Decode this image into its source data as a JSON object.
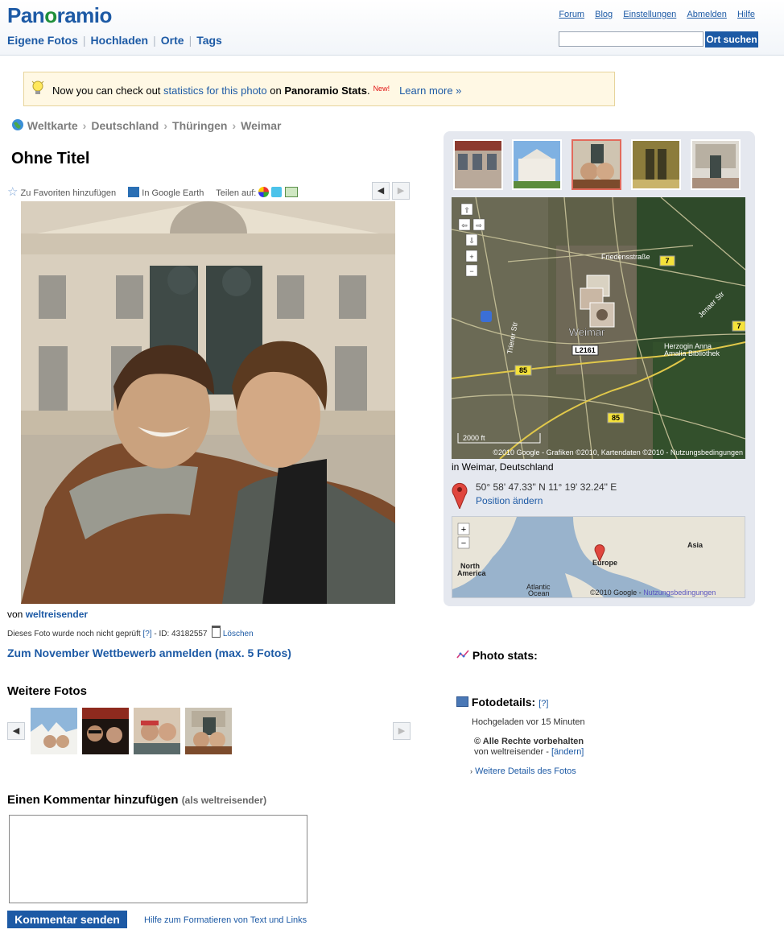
{
  "header": {
    "logo_part1": "Pan",
    "logo_part2": "ramio",
    "nav": [
      "Eigene Fotos",
      "Hochladen",
      "Orte",
      "Tags"
    ],
    "links": [
      "Forum",
      "Blog",
      "Einstellungen",
      "Abmelden",
      "Hilfe"
    ],
    "search_value": "",
    "search_button": "Ort suchen"
  },
  "notice": {
    "pre": "Now you can check out ",
    "link": "statistics for this photo",
    "mid": " on ",
    "brand": "Panoramio Stats",
    "dot": ".",
    "new": "New!",
    "learn_more": "Learn more »"
  },
  "breadcrumb": [
    "Weltkarte",
    "Deutschland",
    "Thüringen",
    "Weimar"
  ],
  "photo": {
    "title": "Ohne Titel",
    "favorite": "Zu Favoriten hinzufügen",
    "google_earth": "In Google Earth",
    "share": "Teilen auf:",
    "by_label": "von ",
    "author": "weltreisender",
    "status": "Dieses Foto wurde noch nicht geprüft",
    "status_help": "[?]",
    "id_text": " - ID: 43182557",
    "delete": "Löschen",
    "contest": "Zum November Wettbewerb anmelden (max. 5 Fotos)"
  },
  "more_photos": {
    "title": "Weitere Fotos"
  },
  "comment": {
    "title": "Einen Kommentar hinzufügen",
    "as_user": "(als weltreisender)",
    "value": "",
    "submit": "Kommentar senden",
    "format_help": "Hilfe zum Formatieren von Text und Links"
  },
  "map": {
    "labels": {
      "weimar": "Weimar",
      "l2161": "L2161",
      "r85a": "85",
      "r85b": "85",
      "r7a": "7",
      "r7b": "7",
      "friedens": "Friedensstraße",
      "herzogin": "Herzogin Anna",
      "amalia": "Amalia Bibliothek",
      "trierer": "Trierer Str",
      "jenaer": "Jenaer Str",
      "scale": "2000 ft",
      "copyright": "©2010 Google - Grafiken ©2010, Kartendaten ©2010 - Nutzungsbedingungen"
    },
    "caption": "in Weimar, Deutschland",
    "coords": "50° 58' 47.33\" N  11° 19' 32.24\" E",
    "change_position": "Position ändern"
  },
  "overview_map": {
    "north_america": "North",
    "north_america2": "America",
    "europe": "Europe",
    "asia": "Asia",
    "atlantic": "Atlantic",
    "ocean": "Ocean",
    "copyright": "©2010 Google - ",
    "terms": "Nutzungsbedingungen"
  },
  "stats": {
    "title": "Photo stats:"
  },
  "details": {
    "title": "Fotodetails:",
    "help": "[?]",
    "uploaded": "Hochgeladen vor 15 Minuten",
    "rights": "© Alle Rechte vorbehalten",
    "rights_by": "von weltreisender - ",
    "change": "[ändern]",
    "more": "Weitere Details des Fotos"
  }
}
